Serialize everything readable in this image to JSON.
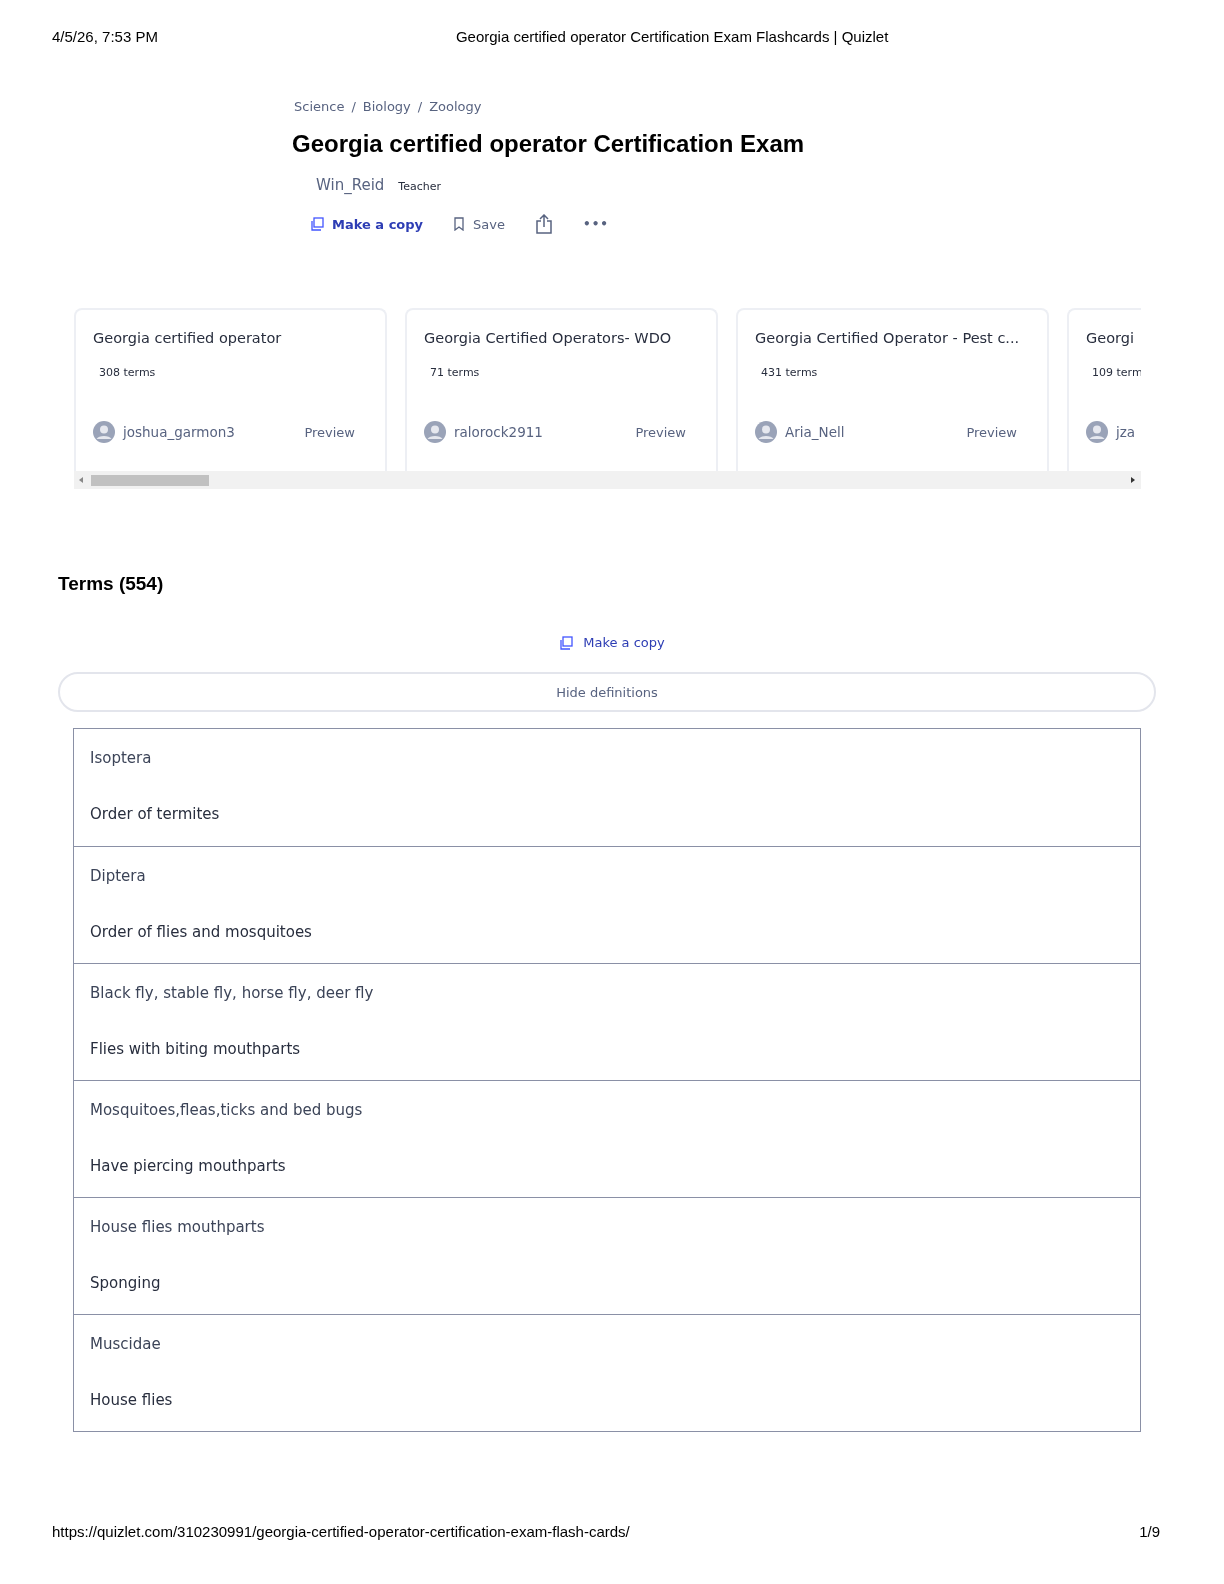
{
  "print_header": {
    "datetime": "4/5/26, 7:53 PM",
    "title": "Georgia certified operator Certification Exam Flashcards | Quizlet"
  },
  "breadcrumbs": [
    "Science",
    "Biology",
    "Zoology"
  ],
  "breadcrumb_separator": "/",
  "title": "Georgia certified operator Certification Exam",
  "author": {
    "name": "Win_Reid",
    "role": "Teacher"
  },
  "actions": {
    "copy": "Make a copy",
    "save": "Save",
    "more": "•••"
  },
  "related_sets": [
    {
      "title": "Georgia certified operator",
      "terms": "308 terms",
      "user": "joshua_garmon3",
      "preview": "Preview",
      "cut": false
    },
    {
      "title": "Georgia Certified Operators- WDO",
      "terms": "71 terms",
      "user": "ralorock2911",
      "preview": "Preview",
      "cut": false
    },
    {
      "title": "Georgia Certified Operator - Pest c...",
      "terms": "431 terms",
      "user": "Aria_Nell",
      "preview": "Preview",
      "cut": false
    },
    {
      "title": "Georgi",
      "terms": "109 term",
      "user": "jza",
      "cut": true
    }
  ],
  "terms_heading": "Terms (554)",
  "copy_link": "Make a copy",
  "hide_button": "Hide definitions",
  "terms": [
    {
      "term": "Isoptera",
      "definition": "Order of termites"
    },
    {
      "term": "Diptera",
      "definition": "Order of flies and mosquitoes"
    },
    {
      "term": "Black fly, stable fly, horse fly, deer fly",
      "definition": "Flies with biting mouthparts"
    },
    {
      "term": "Mosquitoes,fleas,ticks and bed bugs",
      "definition": "Have piercing mouthparts"
    },
    {
      "term": "House flies mouthparts",
      "definition": "Sponging"
    },
    {
      "term": "Muscidae",
      "definition": "House flies"
    }
  ],
  "print_footer": {
    "url": "https://quizlet.com/310230991/georgia-certified-operator-certification-exam-flash-cards/",
    "page": "1/9"
  }
}
